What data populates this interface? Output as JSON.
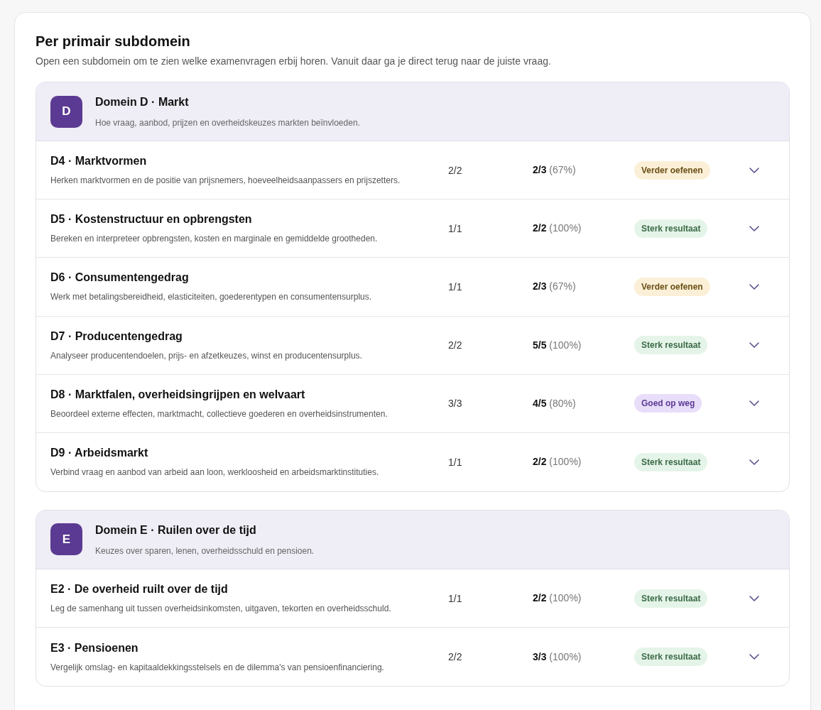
{
  "section": {
    "title": "Per primair subdomein",
    "intro": "Open een subdomein om te zien welke examenvragen erbij horen. Vanuit daar ga je direct terug naar de juiste vraag."
  },
  "domains": [
    {
      "letter": "D",
      "title": "Domein D · Markt",
      "description": "Hoe vraag, aanbod, prijzen en overheidskeuzes markten beïnvloeden.",
      "subdomains": [
        {
          "title": "D4 · Marktvormen",
          "description": "Herken marktvormen en de positie van prijsnemers, hoeveelheidsaanpassers en prijszetters.",
          "count": "2/2",
          "score": "2/3",
          "percent": "(67%)",
          "status": "Verder oefenen",
          "kind": "practice",
          "expanded": false
        },
        {
          "title": "D5 · Kostenstructuur en opbrengsten",
          "description": "Bereken en interpreteer opbrengsten, kosten en marginale en gemiddelde grootheden.",
          "count": "1/1",
          "score": "2/2",
          "percent": "(100%)",
          "status": "Sterk resultaat",
          "kind": "strong",
          "expanded": false
        },
        {
          "title": "D6 · Consumentengedrag",
          "description": "Werk met betalingsbereidheid, elasticiteiten, goederentypen en consumentensurplus.",
          "count": "1/1",
          "score": "2/3",
          "percent": "(67%)",
          "status": "Verder oefenen",
          "kind": "practice",
          "expanded": false
        },
        {
          "title": "D7 · Producentengedrag",
          "description": "Analyseer producentendoelen, prijs- en afzetkeuzes, winst en producentensurplus.",
          "count": "2/2",
          "score": "5/5",
          "percent": "(100%)",
          "status": "Sterk resultaat",
          "kind": "strong",
          "expanded": false
        },
        {
          "title": "D8 · Marktfalen, overheidsingrijpen en welvaart",
          "description": "Beoordeel externe effecten, marktmacht, collectieve goederen en overheidsinstrumenten.",
          "count": "3/3",
          "score": "4/5",
          "percent": "(80%)",
          "status": "Goed op weg",
          "kind": "good",
          "expanded": false
        },
        {
          "title": "D9 · Arbeidsmarkt",
          "description": "Verbind vraag en aanbod van arbeid aan loon, werkloosheid en arbeidsmarktinstituties.",
          "count": "1/1",
          "score": "2/2",
          "percent": "(100%)",
          "status": "Sterk resultaat",
          "kind": "strong",
          "expanded": false
        }
      ]
    },
    {
      "letter": "E",
      "title": "Domein E · Ruilen over de tijd",
      "description": "Keuzes over sparen, lenen, overheidsschuld en pensioen.",
      "subdomains": [
        {
          "title": "E2 · De overheid ruilt over de tijd",
          "description": "Leg de samenhang uit tussen overheidsinkomsten, uitgaven, tekorten en overheidsschuld.",
          "count": "1/1",
          "score": "2/2",
          "percent": "(100%)",
          "status": "Sterk resultaat",
          "kind": "strong",
          "expanded": false
        },
        {
          "title": "E3 · Pensioenen",
          "description": "Vergelijk omslag- en kapitaaldekkingsstelsels en de dilemma's van pensioenfinanciering.",
          "count": "2/2",
          "score": "3/3",
          "percent": "(100%)",
          "status": "Sterk resultaat",
          "kind": "strong",
          "expanded": false
        }
      ]
    }
  ]
}
